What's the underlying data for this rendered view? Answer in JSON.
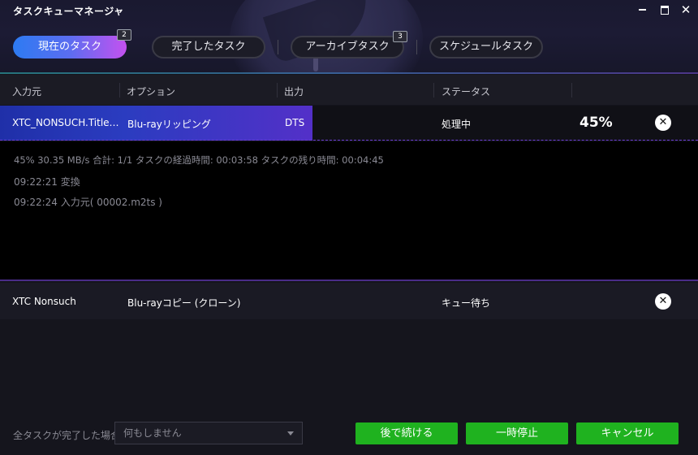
{
  "window": {
    "title": "タスクキューマネージャ",
    "controls": {
      "minimize": "minimize-icon",
      "maximize": "maximize-icon",
      "close": "✕"
    }
  },
  "tabs": [
    {
      "label": "現在のタスク",
      "badge": "2",
      "active": true
    },
    {
      "label": "完了したタスク",
      "badge": "",
      "active": false
    },
    {
      "label": "アーカイブタスク",
      "badge": "3",
      "active": false
    },
    {
      "label": "スケジュールタスク",
      "badge": "",
      "active": false
    }
  ],
  "columns": [
    "入力元",
    "オプション",
    "出力",
    "ステータス"
  ],
  "tasks": [
    {
      "input": "XTC_NONSUCH.Title…",
      "option": "Blu-rayリッピング",
      "output": "DTS",
      "status": "処理中",
      "progress_text": "45%",
      "progress": 0.45,
      "close": "✕"
    },
    {
      "input": "XTC Nonsuch",
      "option": "Blu-rayコピー (クローン)",
      "output": "",
      "status": "キュー待ち",
      "close": "✕"
    }
  ],
  "log": [
    "45%  30.35 MB/s   合計: 1/1  タスクの経過時間: 00:03:58  タスクの残り時間: 00:04:45",
    "09:22:21    変換",
    "09:22:24    入力元( 00002.m2ts )"
  ],
  "footer": {
    "on_complete_label": "全タスクが完了した場合:",
    "on_complete_value": "何もしません",
    "buttons": {
      "later": "後で続ける",
      "pause": "一時停止",
      "cancel": "キャンセル"
    }
  },
  "colors": {
    "accent_green": "#1fb21f",
    "tab_gradient_start": "#2d7bf2",
    "tab_gradient_end": "#c551f0",
    "progress_blue": "#2b3cc0",
    "divider_purple": "#4a2c88"
  }
}
